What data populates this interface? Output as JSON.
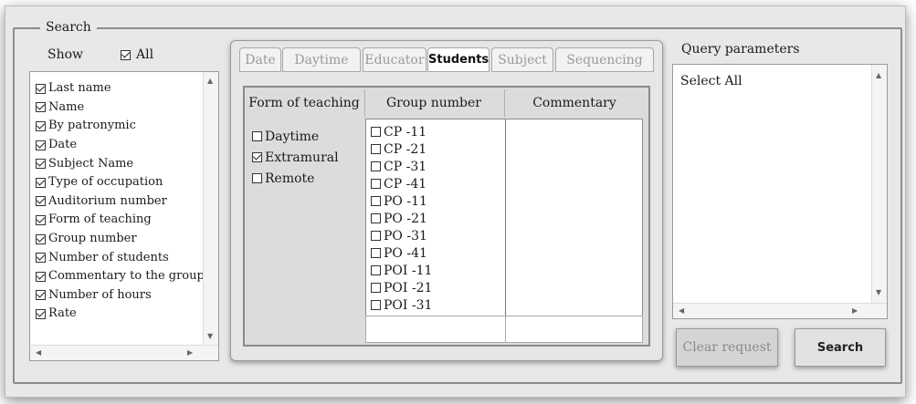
{
  "group_title": "Search",
  "show": {
    "label": "Show",
    "all_label": "All",
    "all_checked": true
  },
  "fields": [
    {
      "label": "Last name",
      "checked": true
    },
    {
      "label": "Name",
      "checked": true
    },
    {
      "label": "By patronymic",
      "checked": true
    },
    {
      "label": "Date",
      "checked": true
    },
    {
      "label": "Subject Name",
      "checked": true
    },
    {
      "label": "Type of occupation",
      "checked": true
    },
    {
      "label": "Auditorium number",
      "checked": true
    },
    {
      "label": "Form of teaching",
      "checked": true
    },
    {
      "label": "Group number",
      "checked": true
    },
    {
      "label": "Number of students",
      "checked": true
    },
    {
      "label": "Commentary to the group",
      "checked": true
    },
    {
      "label": "Number of hours",
      "checked": true
    },
    {
      "label": "Rate",
      "checked": true
    }
  ],
  "tabs": [
    {
      "label": "Date",
      "active": false
    },
    {
      "label": "Daytime",
      "active": false
    },
    {
      "label": "Educator",
      "active": false
    },
    {
      "label": "Students",
      "active": true
    },
    {
      "label": "Subject",
      "active": false
    },
    {
      "label": "Sequencing",
      "active": false
    }
  ],
  "columns": {
    "form_of_teaching": "Form of teaching",
    "group_number": "Group number",
    "commentary": "Commentary"
  },
  "forms": [
    {
      "label": "Daytime",
      "checked": false
    },
    {
      "label": "Extramural",
      "checked": true
    },
    {
      "label": "Remote",
      "checked": false
    }
  ],
  "groups": [
    {
      "label": "CP -11",
      "checked": false
    },
    {
      "label": "CP -21",
      "checked": false
    },
    {
      "label": "CP -31",
      "checked": false
    },
    {
      "label": "CP -41",
      "checked": false
    },
    {
      "label": "PO -11",
      "checked": false
    },
    {
      "label": "PO -21",
      "checked": false
    },
    {
      "label": "PO -31",
      "checked": false
    },
    {
      "label": "PO -41",
      "checked": false
    },
    {
      "label": "POI -11",
      "checked": false
    },
    {
      "label": "POI -21",
      "checked": false
    },
    {
      "label": "POI -31",
      "checked": false
    }
  ],
  "query": {
    "title": "Query parameters",
    "text": "Select All"
  },
  "buttons": {
    "clear": "Clear request",
    "search": "Search"
  }
}
